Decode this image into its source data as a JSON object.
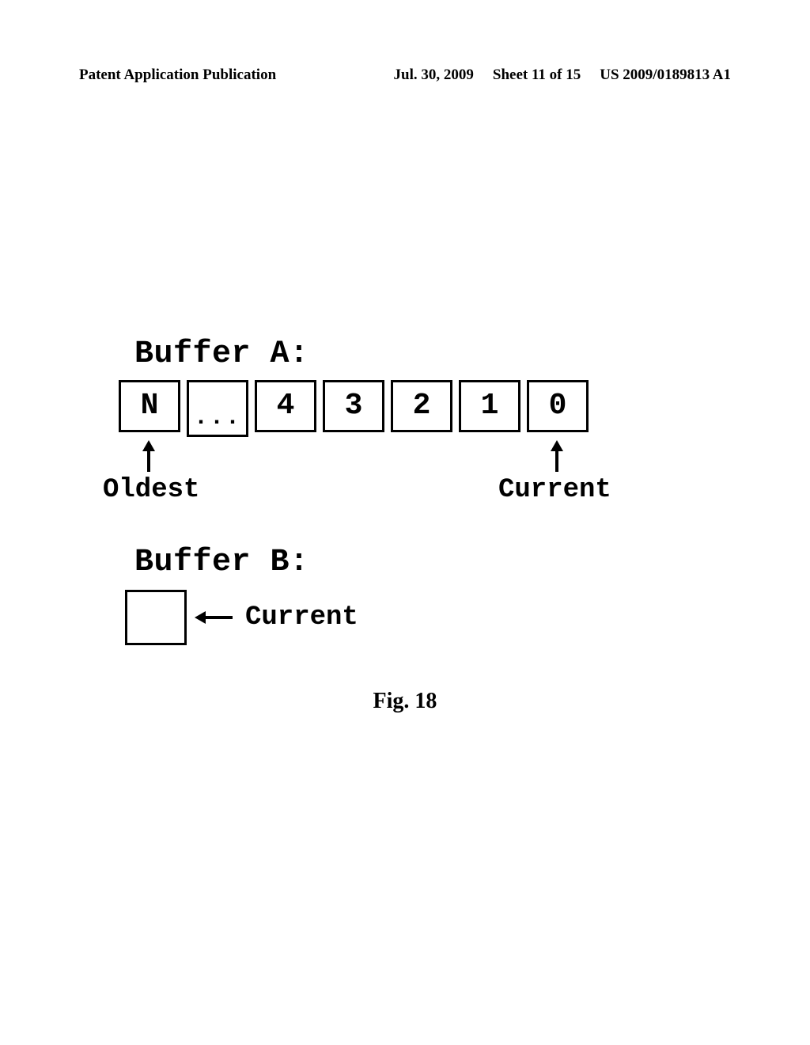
{
  "header": {
    "publication": "Patent Application Publication",
    "date": "Jul. 30, 2009",
    "sheet": "Sheet 11 of 15",
    "pubno": "US 2009/0189813 A1"
  },
  "bufferA": {
    "label": "Buffer A:",
    "cells": [
      "N",
      "...",
      "4",
      "3",
      "2",
      "1",
      "0"
    ],
    "ptr_oldest": "Oldest",
    "ptr_current": "Current"
  },
  "bufferB": {
    "label": "Buffer B:",
    "ptr_current": "Current"
  },
  "caption": "Fig. 18"
}
